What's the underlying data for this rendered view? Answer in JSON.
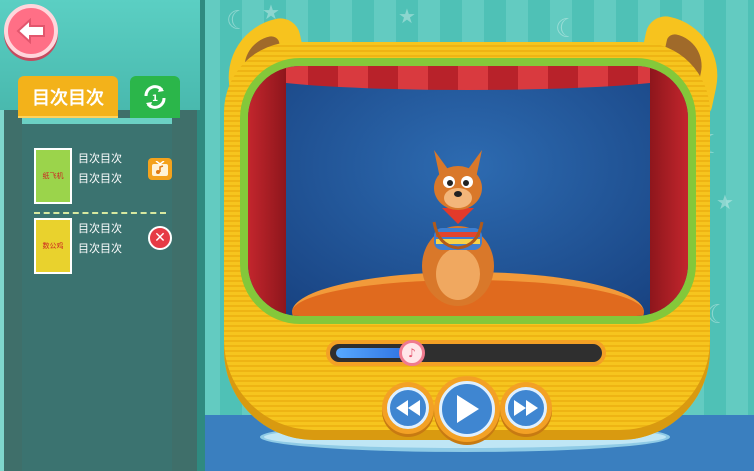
{
  "sidebar": {
    "tab_toc_label": "目次目次",
    "playlist": [
      {
        "cover_text": "纸飞机",
        "line1": "目次目次",
        "line2": "目次目次",
        "action": "music-tv-icon"
      },
      {
        "cover_text": "数公鸡",
        "line1": "目次目次",
        "line2": "目次目次",
        "action": "delete-icon"
      }
    ]
  },
  "player": {
    "progress": 0.29,
    "buttons": [
      "rewind",
      "play",
      "fast-forward"
    ]
  },
  "colors": {
    "accent": "#f3a125",
    "tab_toc": "#f3b21a",
    "tab_loop": "#2bb64a",
    "back": "#ff6f86",
    "delete": "#e63b45"
  }
}
